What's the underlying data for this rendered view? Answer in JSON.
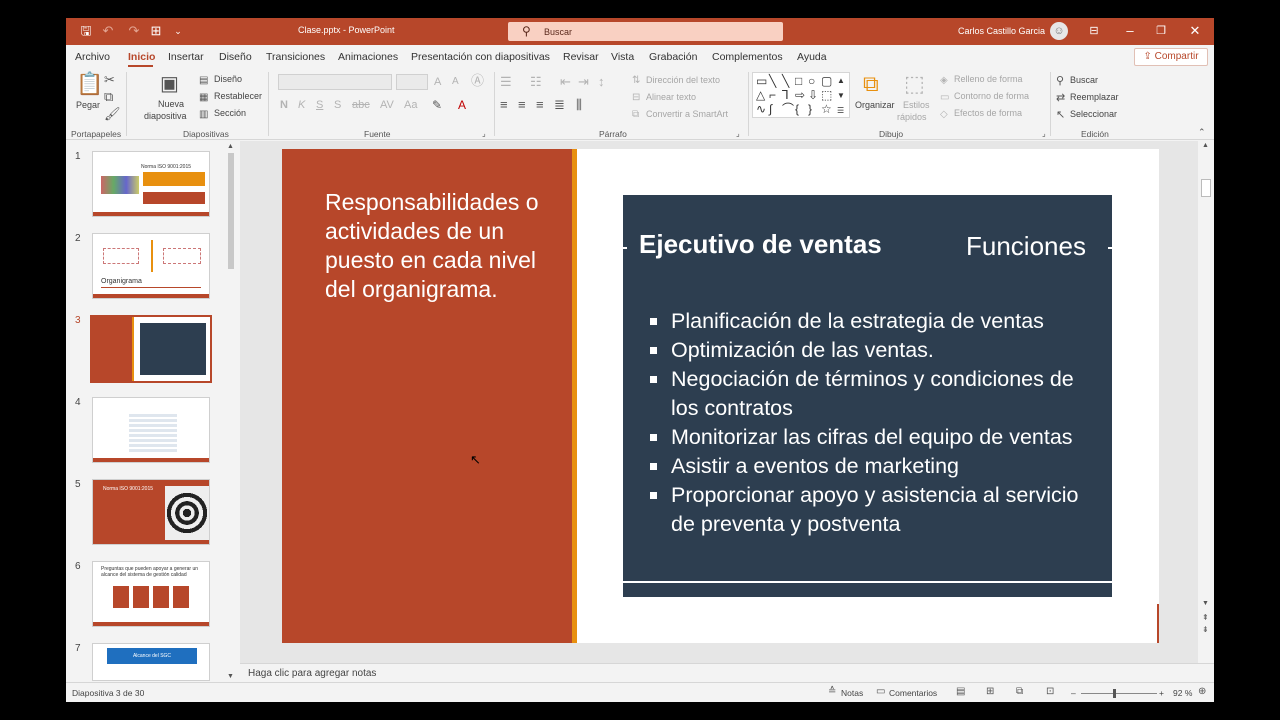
{
  "titlebar": {
    "doc_title": "Clase.pptx  -  PowerPoint",
    "search_placeholder": "Buscar",
    "user_name": "Carlos Castillo Garcia"
  },
  "menu": {
    "tabs": [
      "Archivo",
      "Inicio",
      "Insertar",
      "Diseño",
      "Transiciones",
      "Animaciones",
      "Presentación con diapositivas",
      "Revisar",
      "Vista",
      "Grabación",
      "Complementos",
      "Ayuda"
    ],
    "active_tab": "Inicio",
    "share_label": "Compartir"
  },
  "ribbon": {
    "pegar": "Pegar",
    "nueva_line1": "Nueva",
    "nueva_line2": "diapositiva",
    "diseno": "Diseño",
    "restablecer": "Restablecer",
    "seccion": "Sección",
    "direccion_texto": "Dirección del texto",
    "alinear_texto": "Alinear texto",
    "convertir_smartart": "Convertir a SmartArt",
    "organizar": "Organizar",
    "estilos_line1": "Estilos",
    "estilos_line2": "rápidos",
    "relleno": "Relleno de forma",
    "contorno": "Contorno de forma",
    "efectos": "Efectos de forma",
    "buscar": "Buscar",
    "reemplazar": "Reemplazar",
    "seleccionar": "Seleccionar",
    "groups": {
      "portapapeles": "Portapapeles",
      "diapositivas": "Diapositivas",
      "fuente": "Fuente",
      "parrafo": "Párrafo",
      "dibujo": "Dibujo",
      "edicion": "Edición"
    }
  },
  "thumbnails": [
    {
      "num": "1",
      "label": "Norma ISO 9001:2015"
    },
    {
      "num": "2",
      "label": "Organigrama"
    },
    {
      "num": "3",
      "label": ""
    },
    {
      "num": "4",
      "label": ""
    },
    {
      "num": "5",
      "label": "Norma ISO 9001:2015"
    },
    {
      "num": "6",
      "label": "Preguntas que pueden apoyar a generar un alcance del sistema de gestión calidad"
    },
    {
      "num": "7",
      "label": "Alcance del SGC"
    }
  ],
  "active_slide": 3,
  "slide": {
    "heading": "Responsabilidades o actividades de un puesto en cada nivel del organigrama.",
    "panel_title": "Ejecutivo de ventas",
    "panel_subtitle": "Funciones",
    "bullets": [
      "Planificación de la estrategia de ventas",
      "Optimización de las ventas.",
      "Negociación de términos y condiciones de los contratos",
      "Monitorizar las cifras del equipo de ventas",
      "Asistir a eventos de marketing",
      "Proporcionar apoyo y asistencia al servicio de preventa y postventa"
    ]
  },
  "notes_placeholder": "Haga clic para agregar notas",
  "status": {
    "slide_info": "Diapositiva 3 de 30",
    "notas": "Notas",
    "comentarios": "Comentarios",
    "zoom": "92 %"
  },
  "colors": {
    "accent": "#b7472a",
    "slide_orange": "#e8900f",
    "panel_navy": "#2d3e50"
  }
}
